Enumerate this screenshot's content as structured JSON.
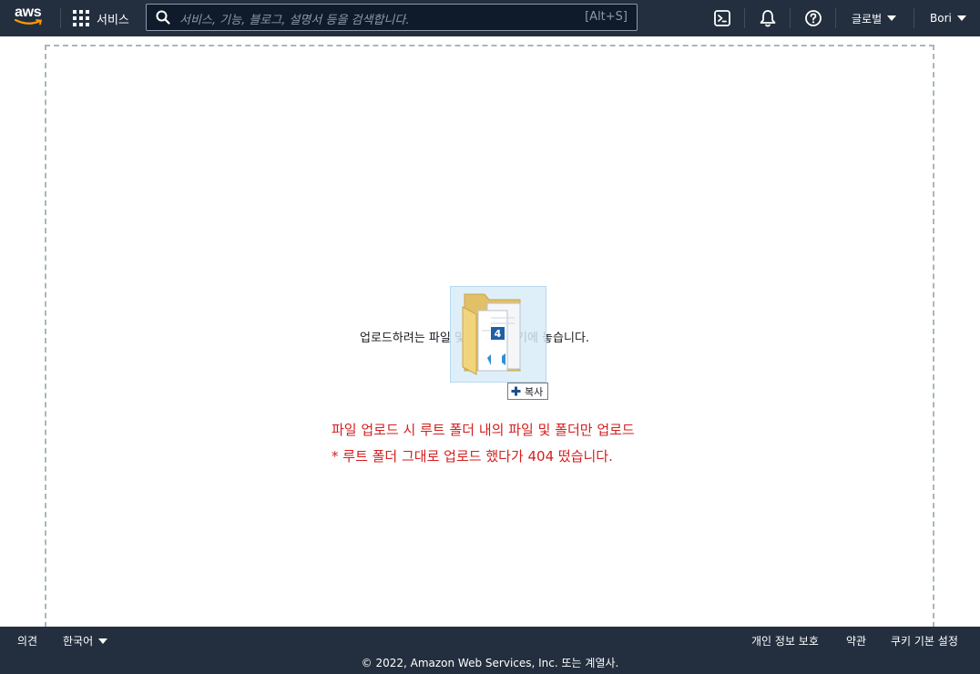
{
  "header": {
    "logo": "aws",
    "services_label": "서비스",
    "search": {
      "placeholder": "서비스, 기능, 블로그, 설명서 등을 검색합니다.",
      "shortcut": "[Alt+S]"
    },
    "icons": [
      "cloudshell-icon",
      "bell-icon",
      "help-icon"
    ],
    "region_label": "글로벌",
    "account_label": "Bori"
  },
  "dropzone": {
    "prompt": "업로드하려는 파일 및 폴더를 여기에 놓습니다.",
    "drag_count": "4",
    "copy_label": "복사",
    "notes": [
      "파일 업로드 시 루트 폴더 내의 파일 및 폴더만 업로드",
      "* 루트 폴더 그대로 업로드 했다가 404 떴습니다."
    ],
    "note_color": "#d41e1e"
  },
  "footer": {
    "feedback": "의견",
    "language": "한국어",
    "privacy": "개인 정보 보호",
    "terms": "약관",
    "cookies": "쿠키 기본 설정",
    "copyright": "© 2022, Amazon Web Services, Inc. 또는 계열사."
  },
  "colors": {
    "nav_bg": "#232f3e",
    "logo_smile": "#ff9900"
  }
}
